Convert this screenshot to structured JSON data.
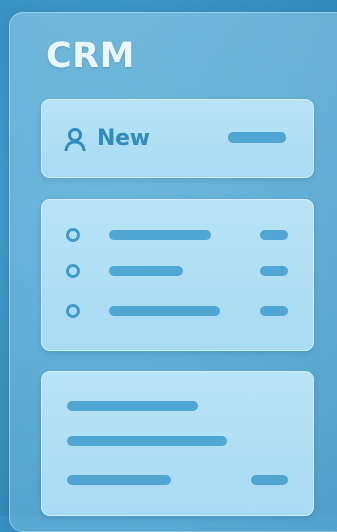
{
  "app": {
    "title": "CRM"
  },
  "new_card": {
    "label": "New",
    "icon": "user-icon"
  },
  "colors": {
    "background": "#3a93c2",
    "accent": "#2f8cc1",
    "placeholder_bar": "#4fa6d3",
    "card": "#b9e3f6"
  },
  "list_card": {
    "item_count": 3
  },
  "text_card": {
    "line_count": 3
  }
}
